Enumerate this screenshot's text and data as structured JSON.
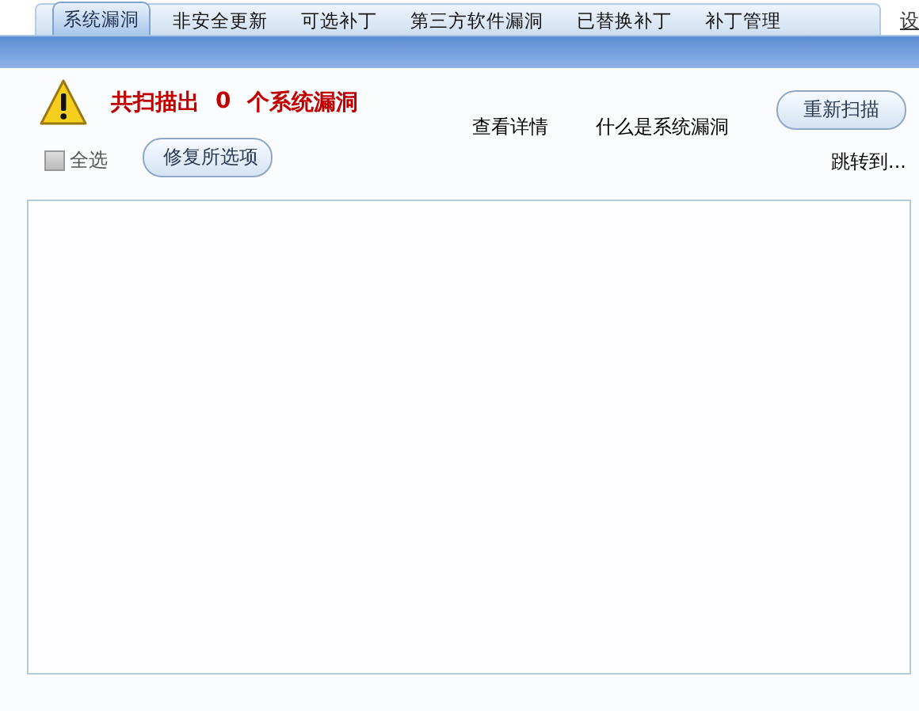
{
  "tabs": [
    {
      "label": "系统漏洞",
      "selected": true
    },
    {
      "label": "非安全更新",
      "selected": false
    },
    {
      "label": "可选补丁",
      "selected": false
    },
    {
      "label": "第三方软件漏洞",
      "selected": false
    },
    {
      "label": "已替换补丁",
      "selected": false
    },
    {
      "label": "补丁管理",
      "selected": false
    }
  ],
  "settings_link": "设",
  "summary": {
    "prefix": "共扫描出",
    "count": "0",
    "suffix": "个系统漏洞"
  },
  "links": [
    "查看详情",
    "什么是系统漏洞"
  ],
  "rescan_button": "重新扫描",
  "select_all": {
    "label": "全选",
    "checked": false,
    "disabled": true
  },
  "fix_button": "修复所选项",
  "jump_link": "跳转到..."
}
